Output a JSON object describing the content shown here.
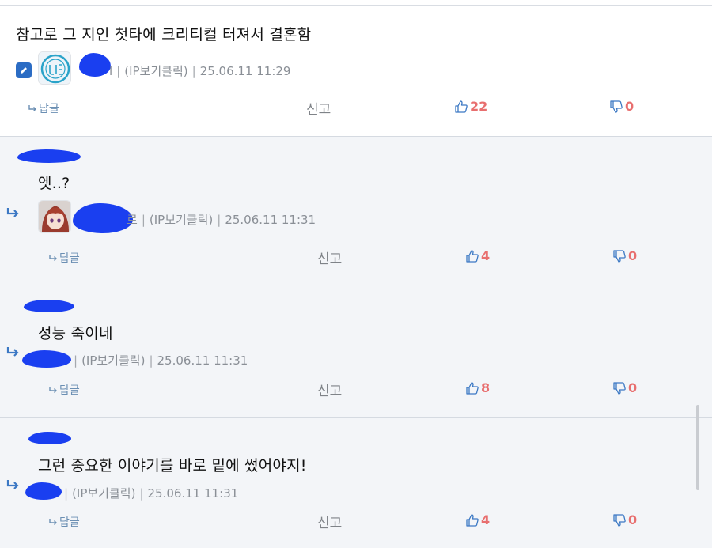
{
  "colors": {
    "redaction": "#1a3ff0",
    "like_count": "#e86f6f",
    "icon_blue": "#3b78c4",
    "reply_bg": "#f3f5f8"
  },
  "comments": [
    {
      "text": "참고로 그 지인 첫타에 크리티컬 터져서 결혼함",
      "author_suffix": "l",
      "ip": "(IP보기클릭)",
      "date": "25.06.11 11:29",
      "reply_label": "답글",
      "report_label": "신고",
      "likes": "22",
      "dislikes": "0",
      "avatar": "circle-logo-avatar",
      "edited": true
    },
    {
      "text": "엣..?",
      "author_suffix": "르",
      "ip": "(IP보기클릭)",
      "date": "25.06.11 11:31",
      "reply_label": "답글",
      "report_label": "신고",
      "likes": "4",
      "dislikes": "0",
      "avatar": "anime-girl-avatar"
    },
    {
      "text": "성능 죽이네",
      "author_suffix": "",
      "ip": "(IP보기클릭)",
      "date": "25.06.11 11:31",
      "reply_label": "답글",
      "report_label": "신고",
      "likes": "8",
      "dislikes": "0"
    },
    {
      "text": "그런 중요한 이야기를 바로 밑에 썼어야지!",
      "author_suffix": "",
      "ip": "(IP보기클릭)",
      "date": "25.06.11 11:31",
      "reply_label": "답글",
      "report_label": "신고",
      "likes": "4",
      "dislikes": "0"
    }
  ]
}
